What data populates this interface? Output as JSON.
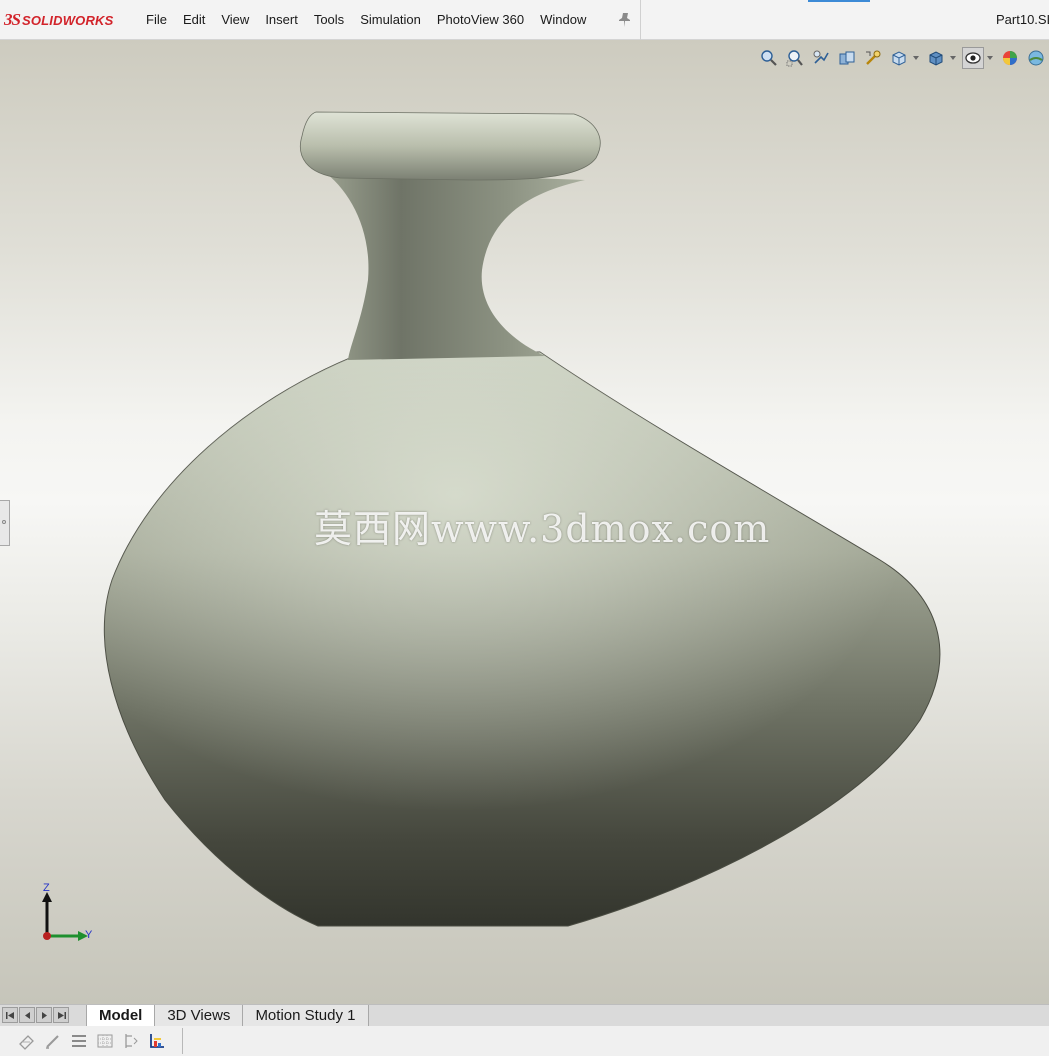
{
  "app": {
    "logo_mark": "3S",
    "logo_text": "SOLIDWORKS",
    "document_title": "Part10.SL"
  },
  "menu": {
    "items": [
      "File",
      "Edit",
      "View",
      "Insert",
      "Tools",
      "Simulation",
      "PhotoView 360",
      "Window"
    ]
  },
  "heads_up_toolbar": {
    "icons": [
      "zoom-to-fit-icon",
      "zoom-to-area-icon",
      "previous-view-icon",
      "section-view-icon",
      "dynamic-annotation-views-icon",
      "view-orientation-icon",
      "display-style-icon",
      "hide-show-items-icon",
      "edit-appearance-icon"
    ]
  },
  "viewport": {
    "watermark": "莫西网www.3dmox.com",
    "triad": {
      "z_label": "Z",
      "y_label": "Y"
    }
  },
  "bottom_tabs": [
    {
      "label": "Model",
      "active": true
    },
    {
      "label": "3D Views",
      "active": false
    },
    {
      "label": "Motion Study 1",
      "active": false
    }
  ],
  "status_bar": {
    "icons": [
      "filter-appearance-icon",
      "sketch-filter-icon",
      "list-icon",
      "table-icon",
      "dimension-icon",
      "axis-chart-icon"
    ]
  },
  "colors": {
    "brand": "#d2232a",
    "vase_light": "#c9cfc0",
    "vase_dark": "#35372f",
    "accent": "#3c8ad6"
  }
}
